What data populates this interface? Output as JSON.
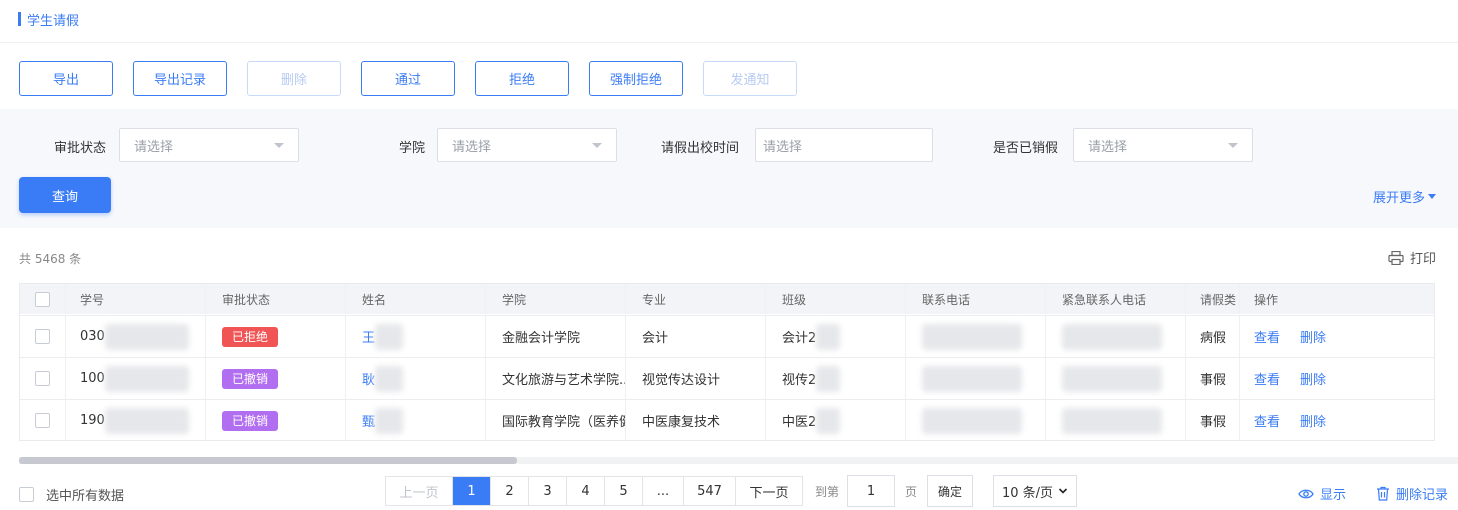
{
  "header": {
    "title": "学生请假"
  },
  "toolbar": {
    "export": "导出",
    "export_records": "导出记录",
    "delete": "删除",
    "approve": "通过",
    "reject": "拒绝",
    "force_reject": "强制拒绝",
    "send_notice": "发通知"
  },
  "filters": {
    "status_label": "审批状态",
    "college_label": "学院",
    "leave_time_label": "请假出校时间",
    "cancelled_label": "是否已销假",
    "placeholder": "请选择",
    "query_button": "查询",
    "expand_more": "展开更多"
  },
  "summary": {
    "count_text": "共 5468 条",
    "print_label": "打印"
  },
  "table": {
    "columns": [
      "学号",
      "审批状态",
      "姓名",
      "学院",
      "专业",
      "班级",
      "联系电话",
      "紧急联系人电话",
      "请假类",
      "操作"
    ],
    "rows": [
      {
        "id_prefix": "030",
        "status": "已拒绝",
        "status_color": "#f05454",
        "name_prefix": "王",
        "college": "金融会计学院",
        "major": "会计",
        "class_prefix": "会计2",
        "leave_type": "病假"
      },
      {
        "id_prefix": "100",
        "status": "已撤销",
        "status_color": "#b26ef0",
        "name_prefix": "耿",
        "college": "文化旅游与艺术学院...",
        "major": "视觉传达设计",
        "class_prefix": "视传2",
        "leave_type": "事假"
      },
      {
        "id_prefix": "190",
        "status": "已撤销",
        "status_color": "#b26ef0",
        "name_prefix": "甄",
        "college": "国际教育学院（医养健",
        "major": "中医康复技术",
        "class_prefix": "中医2",
        "leave_type": "事假"
      }
    ],
    "actions": {
      "view": "查看",
      "delete": "删除"
    }
  },
  "footer": {
    "select_all": "选中所有数据",
    "prev": "上一页",
    "pages": [
      "1",
      "2",
      "3",
      "4",
      "5",
      "...",
      "547"
    ],
    "current_page": "1",
    "next": "下一页",
    "goto_label": "到第",
    "goto_value": "1",
    "page_unit": "页",
    "confirm": "确定",
    "page_size": "10 条/页",
    "display": "显示",
    "delete_records": "删除记录"
  },
  "colors": {
    "accent": "#3a7cf5",
    "rejected": "#f05454",
    "cancelled": "#b26ef0"
  }
}
